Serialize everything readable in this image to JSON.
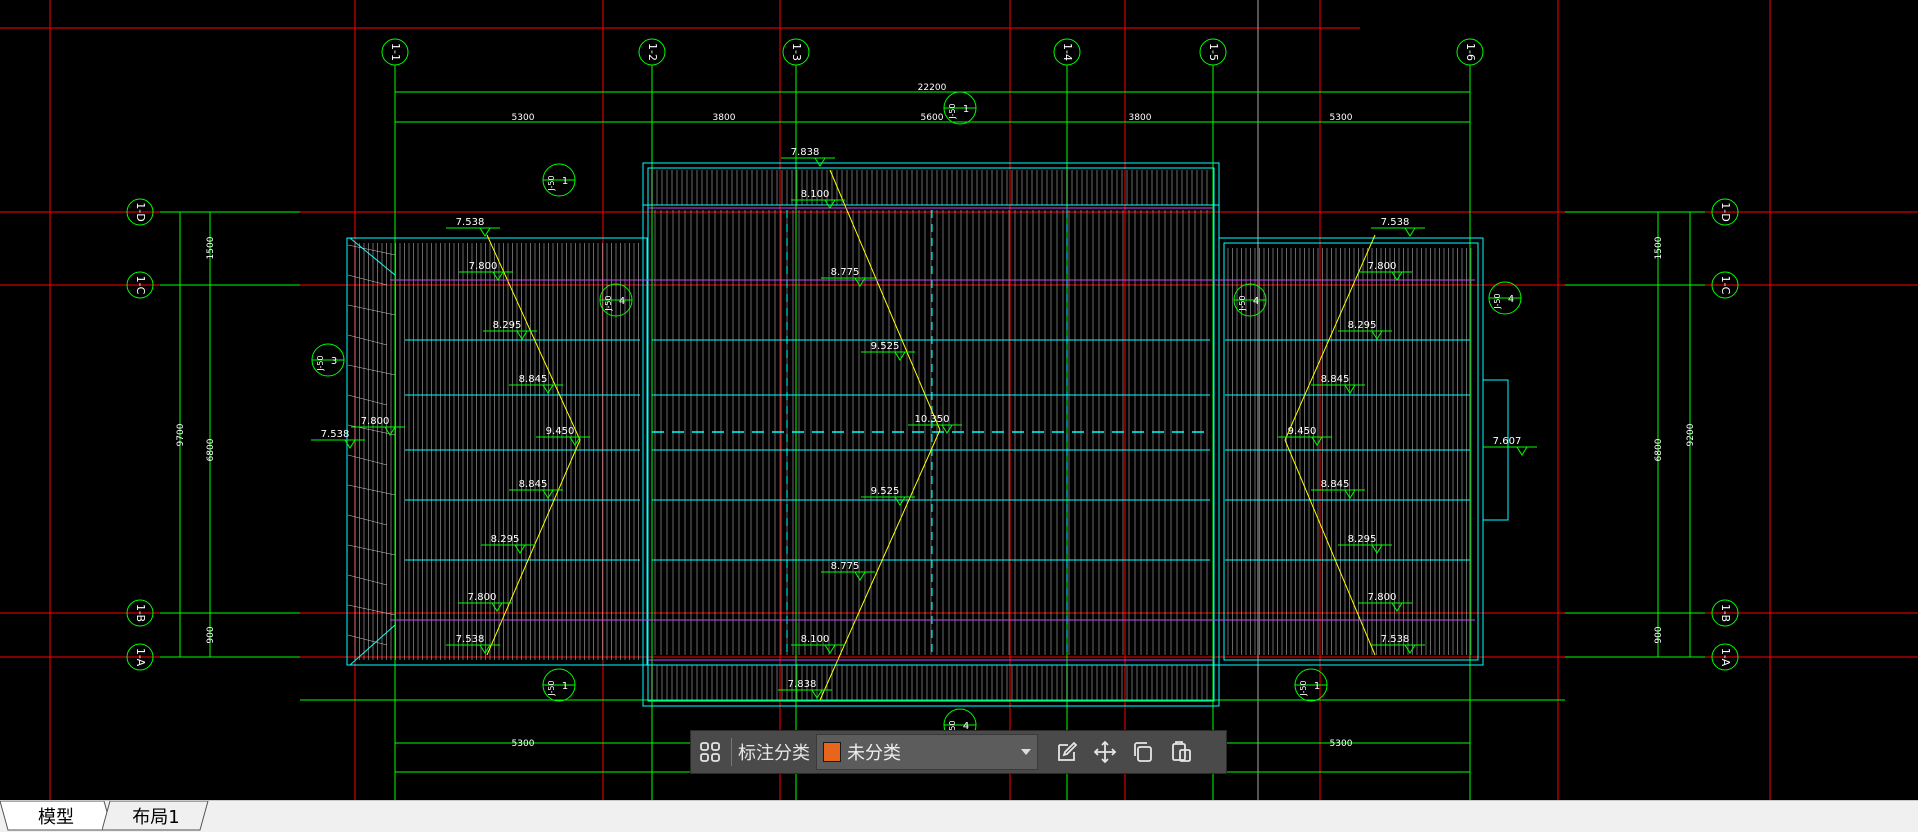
{
  "colors": {
    "background": "#000000",
    "axis_red": "#ff0000",
    "dim_green": "#00ff00",
    "roof_cyan": "#00ffff",
    "slope_yellow": "#ffff00",
    "toolbar_bg": "#4a4a4a",
    "category_swatch": "#e8661c"
  },
  "grid_axes": {
    "vertical": [
      "1-1",
      "1-2",
      "1-3",
      "1-4",
      "1-5",
      "1-6"
    ],
    "horizontal_left": [
      "1-D",
      "1-C",
      "1-B",
      "1-A"
    ],
    "horizontal_right": [
      "1-D",
      "1-C",
      "1-B",
      "1-A"
    ]
  },
  "dimensions": {
    "total": "22200",
    "top_spans": [
      "5300",
      "3800",
      "5600",
      "3800",
      "5300"
    ],
    "bottom_spans": [
      "5300",
      "5300"
    ],
    "left": [
      "1500",
      "9700",
      "6800",
      "900"
    ],
    "right": [
      "1500",
      "9200",
      "6800",
      "900"
    ]
  },
  "elevations": {
    "center_ridge": "10.350",
    "center_items": [
      "7.838",
      "8.100",
      "8.775",
      "9.525",
      "9.525",
      "8.775",
      "8.100",
      "7.838"
    ],
    "left_items": [
      "7.538",
      "7.800",
      "8.295",
      "8.845",
      "7.800",
      "7.538",
      "9.450",
      "8.845",
      "8.295",
      "7.800",
      "7.538"
    ],
    "right_items": [
      "7.538",
      "7.800",
      "8.295",
      "8.845",
      "9.450",
      "8.845",
      "8.295",
      "7.800",
      "7.538",
      "7.607"
    ]
  },
  "detail_refs": {
    "main": "J-50",
    "numbers": [
      "1",
      "1",
      "4",
      "4",
      "3",
      "4",
      "1",
      "1",
      "4"
    ]
  },
  "toolbar": {
    "layout_icon": "grid-layout-icon",
    "label": "标注分类",
    "category_value": "未分类",
    "tools": [
      "edit-icon",
      "move-icon",
      "copy-icon",
      "paste-icon"
    ]
  },
  "tabs": {
    "model": "模型",
    "layout1": "布局1"
  }
}
